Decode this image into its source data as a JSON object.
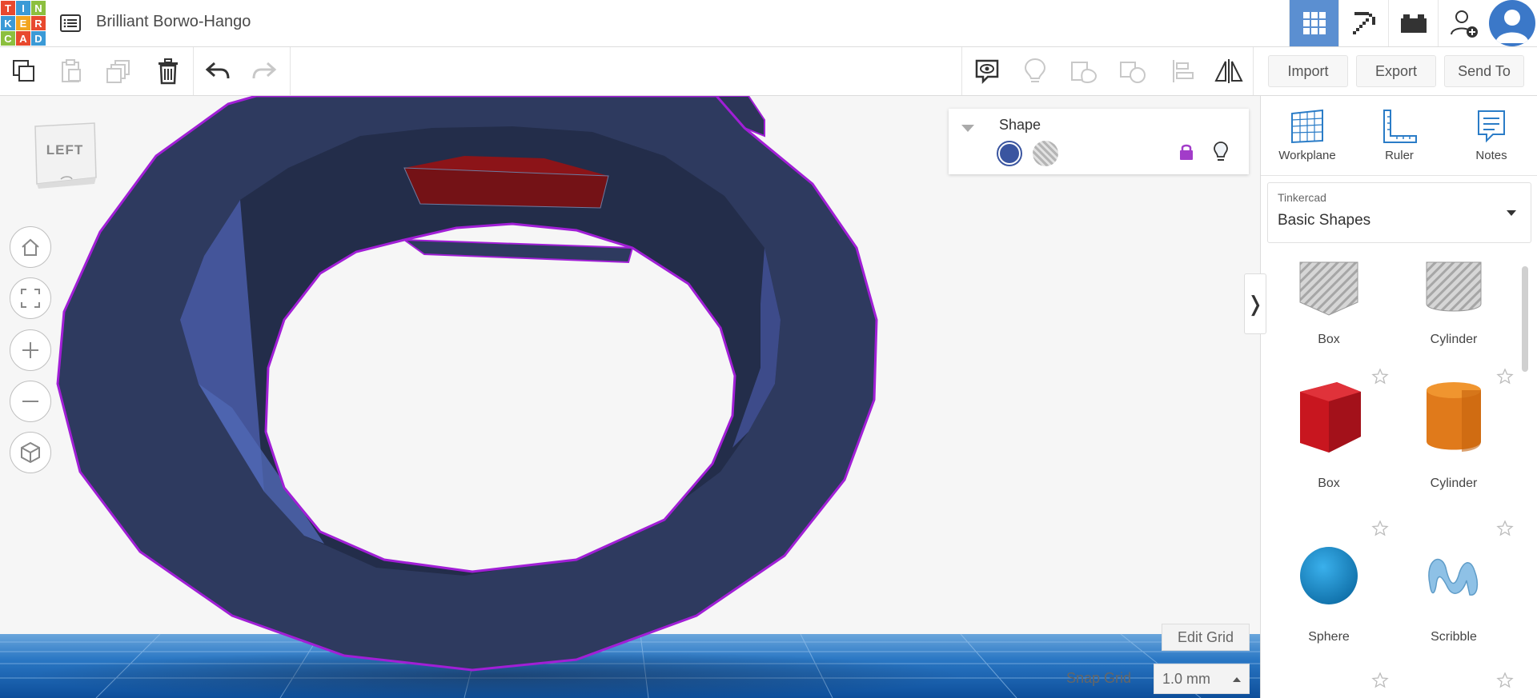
{
  "header": {
    "logo_letters": [
      "T",
      "I",
      "N",
      "K",
      "E",
      "R",
      "C",
      "A",
      "D"
    ],
    "design_title": "Brilliant Borwo-Hango"
  },
  "toolbar": {
    "import_label": "Import",
    "export_label": "Export",
    "send_to_label": "Send To"
  },
  "viewport": {
    "viewcube_face": "LEFT",
    "shape_panel": {
      "title": "Shape",
      "solid_color": "#3a55a0",
      "hole_color": "#b5b5b5",
      "lock_color": "#a23cc9"
    },
    "edit_grid_label": "Edit Grid",
    "snap_grid_label": "Snap Grid",
    "snap_grid_value": "1.0 mm",
    "collapse_glyph": "❭"
  },
  "sidebar": {
    "tools": [
      {
        "label": "Workplane",
        "icon": "workplane-icon"
      },
      {
        "label": "Ruler",
        "icon": "ruler-icon"
      },
      {
        "label": "Notes",
        "icon": "notes-icon"
      }
    ],
    "library_small": "Tinkercad",
    "library_name": "Basic Shapes",
    "shapes": [
      {
        "name": "Box",
        "kind": "box-hole"
      },
      {
        "name": "Cylinder",
        "kind": "cylinder-hole"
      },
      {
        "name": "Box",
        "kind": "box"
      },
      {
        "name": "Cylinder",
        "kind": "cylinder"
      },
      {
        "name": "Sphere",
        "kind": "sphere"
      },
      {
        "name": "Scribble",
        "kind": "scribble"
      }
    ]
  },
  "colors": {
    "accent": "#5b8fd1",
    "ring_fill": "#2f3a5e",
    "selection_outline": "#a11fd6",
    "box_red": "#d0202a",
    "cylinder_orange": "#e07a1b",
    "sphere_blue": "#1a8fd0"
  }
}
